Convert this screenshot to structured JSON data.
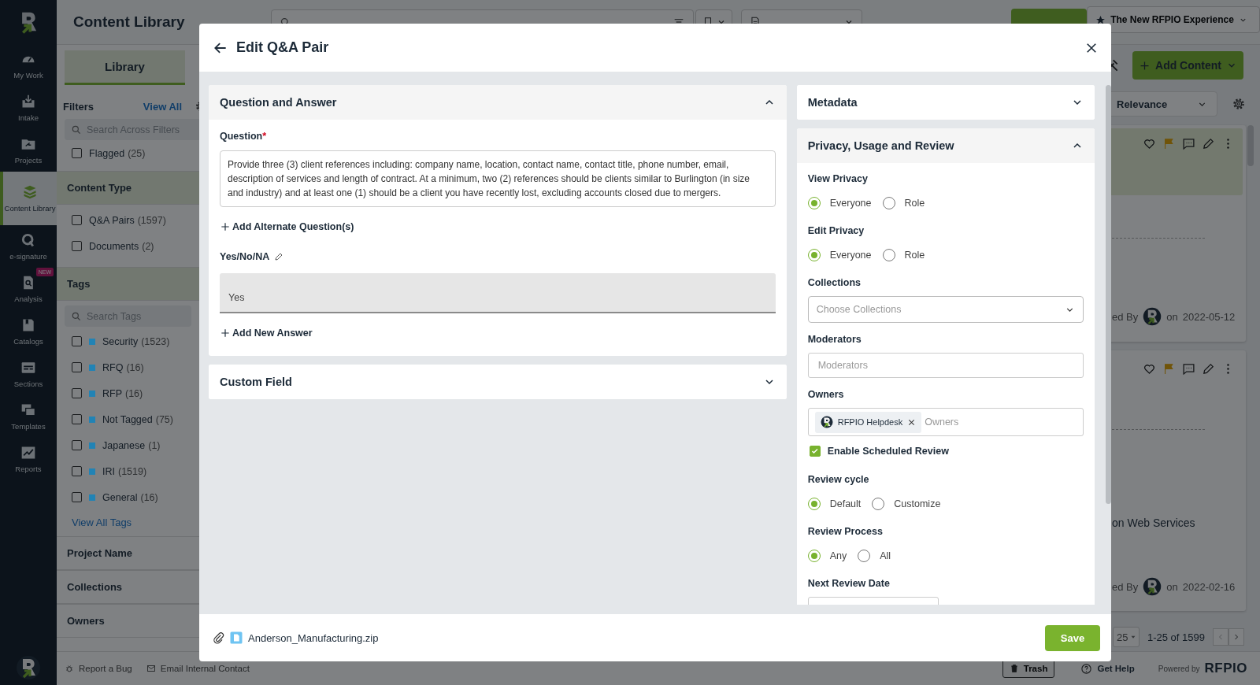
{
  "nav": {
    "items": [
      {
        "label": "My Work",
        "selected": false
      },
      {
        "label": "Intake",
        "selected": false
      },
      {
        "label": "Projects",
        "selected": false
      },
      {
        "label": "Content Library",
        "selected": true
      },
      {
        "label": "e-signature",
        "selected": false
      },
      {
        "label": "Analysis",
        "selected": false,
        "badge": "NEW"
      },
      {
        "label": "Catalogs",
        "selected": false
      },
      {
        "label": "Sections",
        "selected": false
      },
      {
        "label": "Templates",
        "selected": false
      },
      {
        "label": "Reports",
        "selected": false
      }
    ]
  },
  "header": {
    "title": "Content Library",
    "experience": "The New RFPIO Experience"
  },
  "filters": {
    "tab": "Library",
    "title": "Filters",
    "view_all": "View All",
    "search_placeholder": "Search Across Filters",
    "flagged": {
      "label": "Flagged",
      "count": "(25)",
      "checked": false
    },
    "sections": [
      {
        "title": "Content Type",
        "expanded": true,
        "items": [
          {
            "label": "Q&A Pairs",
            "count": "(1597)",
            "checked": false
          },
          {
            "label": "Documents",
            "count": "(2)",
            "checked": false
          }
        ]
      },
      {
        "title": "Tags",
        "expanded": true,
        "search_placeholder": "Search Tags",
        "items": [
          {
            "label": "Security",
            "count": "(1523)",
            "checked": false,
            "color": "#2183b5"
          },
          {
            "label": "RFQ",
            "count": "(16)",
            "checked": false,
            "color": "#2183b5"
          },
          {
            "label": "RFP",
            "count": "(16)",
            "checked": false,
            "color": "#2183b5"
          },
          {
            "label": "Not Tagged",
            "count": "(75)",
            "checked": false,
            "color": "#2183b5"
          },
          {
            "label": "Japanese",
            "count": "(1)",
            "checked": false,
            "color": "#2183b5"
          },
          {
            "label": "IRI",
            "count": "(1519)",
            "checked": false,
            "color": "#2183b5"
          },
          {
            "label": "General",
            "count": "(16)",
            "checked": false,
            "color": "#2183b5"
          }
        ],
        "link": "View All Tags"
      },
      {
        "title": "Project Name",
        "expanded": false
      },
      {
        "title": "Collections",
        "expanded": false
      },
      {
        "title": "Owners",
        "expanded": false
      }
    ]
  },
  "results": {
    "add_content": "Add Content",
    "sort": "Relevance",
    "cards": [
      {
        "highlighted": true,
        "flagged": true,
        "by": "ed By",
        "on": "on",
        "date": "2022-05-12"
      },
      {
        "highlighted": false,
        "flagged": true,
        "title": "on Web Services",
        "by": "ed By",
        "on": "on",
        "date": "2022-02-16"
      }
    ]
  },
  "pagination": {
    "page_size": "25",
    "range": "1-25 of 1599"
  },
  "bottom_bar": {
    "report": "Report a Bug",
    "email": "Email Internal Contact",
    "trash": "Trash",
    "help": "Get Help",
    "powered_by": "Powered by",
    "brand": "RFPIO"
  },
  "modal": {
    "title": "Edit Q&A Pair",
    "sections": [
      {
        "title": "Question and Answer",
        "expanded": true,
        "question_label": "Question",
        "required_mark": "*",
        "question": "Provide three (3) client references including: company name, location, contact name, contact title, phone number, email, description of services and length of contract. At a minimum, two (2) references should be clients similar to Burlington (in size and industry) and at least one (1) should be a client you have recently lost, excluding accounts closed due to mergers.",
        "add_alternate": "Add Alternate Question(s)",
        "answer_label": "Yes/No/NA",
        "answer": "Yes",
        "add_answer": "Add New Answer"
      },
      {
        "title": "Custom Field",
        "expanded": false
      }
    ],
    "side_sections": [
      {
        "title": "Metadata",
        "expanded": false
      },
      {
        "title": "Privacy, Usage and Review",
        "expanded": true,
        "fields": [
          {
            "kind": "radio",
            "label": "View Privacy",
            "options": [
              {
                "label": "Everyone",
                "selected": true
              },
              {
                "label": "Role",
                "selected": false
              }
            ]
          },
          {
            "kind": "radio",
            "label": "Edit Privacy",
            "options": [
              {
                "label": "Everyone",
                "selected": true
              },
              {
                "label": "Role",
                "selected": false
              }
            ]
          },
          {
            "kind": "select",
            "label": "Collections",
            "placeholder": "Choose Collections"
          },
          {
            "kind": "input",
            "label": "Moderators",
            "placeholder": "Moderators"
          },
          {
            "kind": "tags",
            "label": "Owners",
            "chips": [
              {
                "label": "RFPIO Helpdesk"
              }
            ],
            "placeholder": "Owners"
          },
          {
            "kind": "checkbox",
            "label": "Enable Scheduled Review",
            "checked": true
          },
          {
            "kind": "radio",
            "label": "Review cycle",
            "options": [
              {
                "label": "Default",
                "selected": true
              },
              {
                "label": "Customize",
                "selected": false
              }
            ]
          },
          {
            "kind": "radio",
            "label": "Review Process",
            "options": [
              {
                "label": "Any",
                "selected": true
              },
              {
                "label": "All",
                "selected": false
              }
            ]
          },
          {
            "kind": "date",
            "label": "Next Review Date"
          }
        ]
      }
    ],
    "attachment": "Anderson_Manufacturing.zip",
    "save": "Save"
  }
}
